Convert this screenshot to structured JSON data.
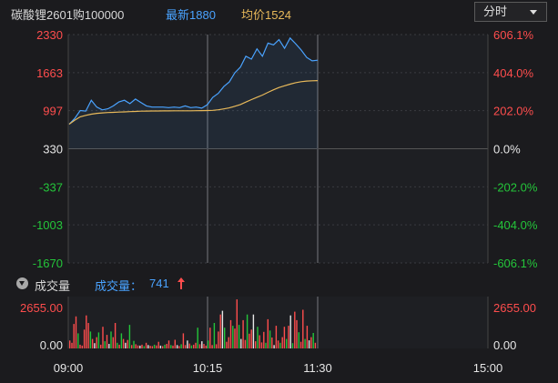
{
  "header": {
    "title": "碳酸锂2601购100000",
    "latest": "最新1880",
    "average": "均价1524",
    "period_label": "分时"
  },
  "volume_header": {
    "title": "成交量",
    "label": "成交量：",
    "value": "741"
  },
  "colors": {
    "up": "#ff4d4d",
    "down": "#24c53a",
    "price_line": "#4aa3ff",
    "avg_line": "#e8b95a",
    "neutral": "#e6e6e6"
  },
  "chart_data": [
    {
      "type": "line",
      "series": [
        {
          "values": [
            760,
            860,
            1000,
            990,
            1180,
            1060,
            1010,
            1030,
            1080,
            1150,
            1180,
            1120,
            1200,
            1140,
            1080,
            1060,
            1060,
            1060,
            1050,
            1060,
            1050,
            1080,
            1050,
            1060,
            1040,
            1100,
            1230,
            1300,
            1420,
            1500,
            1660,
            1760,
            1950,
            1900,
            2080,
            1950,
            2180,
            2150,
            2240,
            2090,
            2270,
            2170,
            2060,
            1930,
            1870,
            1880
          ]
        },
        {
          "values": [
            760,
            830,
            890,
            915,
            935,
            950,
            958,
            964,
            968,
            972,
            976,
            980,
            984,
            988,
            990,
            991,
            992,
            993,
            993,
            994,
            994,
            995,
            995,
            996,
            997,
            999,
            1003,
            1012,
            1028,
            1046,
            1074,
            1104,
            1148,
            1190,
            1232,
            1270,
            1318,
            1362,
            1402,
            1432,
            1462,
            1487,
            1505,
            1515,
            1520,
            1524
          ]
        }
      ],
      "y_left_ticks": [
        "2330",
        "1663",
        "997",
        "330",
        "-337",
        "-1003",
        "-1670"
      ],
      "y_right_ticks": [
        "606.1%",
        "404.0%",
        "202.0%",
        "0.0%",
        "-202.0%",
        "-404.0%",
        "-606.1%"
      ],
      "ylim": [
        -1670,
        2330
      ],
      "x_ticks": [
        "09:00",
        "10:15",
        "11:30",
        "15:00"
      ],
      "grid": true
    },
    {
      "type": "bar",
      "y_left_ticks": [
        "2655.00",
        "0.00"
      ],
      "y_right_ticks": [
        "2655.00",
        "0.00"
      ],
      "ylim": [
        0,
        2655
      ],
      "values": [
        420,
        300,
        1300,
        1700,
        800,
        200,
        150,
        1000,
        1750,
        1350,
        900,
        500,
        280,
        600,
        850,
        200,
        1150,
        380,
        720,
        240,
        900,
        600,
        1350,
        300,
        200,
        800,
        500,
        300,
        450,
        1250,
        180,
        400,
        220,
        160,
        150,
        200,
        120,
        300,
        180,
        140,
        120,
        200,
        160,
        350,
        150,
        120,
        200,
        240,
        420,
        180,
        150,
        460,
        180,
        130,
        220,
        800,
        180,
        420,
        260,
        160,
        200,
        300,
        1100,
        220,
        380,
        240,
        150,
        420,
        1100,
        180,
        1350,
        220,
        900,
        1800,
        2000,
        1100,
        350,
        600,
        1500,
        1200,
        1050,
        2600,
        1250,
        500,
        1500,
        450,
        1800,
        780,
        1000,
        1800,
        380,
        1150,
        700,
        320,
        880,
        300,
        1550,
        950,
        580,
        180,
        1200,
        420,
        300,
        600,
        1150,
        500,
        1200,
        1750,
        280,
        1950,
        1500,
        860,
        350,
        2050,
        500,
        1200,
        430,
        600,
        820,
        300
      ],
      "colors": [
        "up",
        "up",
        "up",
        "up",
        "down",
        "up",
        "up",
        "up",
        "up",
        "up",
        "down",
        "up",
        "neutral",
        "up",
        "down",
        "up",
        "up",
        "down",
        "up",
        "neutral",
        "down",
        "up",
        "up",
        "down",
        "up",
        "down",
        "up",
        "neutral",
        "up",
        "down",
        "up",
        "down",
        "up",
        "up",
        "neutral",
        "up",
        "down",
        "up",
        "neutral",
        "up",
        "up",
        "down",
        "up",
        "up",
        "neutral",
        "up",
        "down",
        "up",
        "up",
        "down",
        "up",
        "up",
        "neutral",
        "up",
        "down",
        "up",
        "up",
        "neutral",
        "up",
        "down",
        "up",
        "up",
        "down",
        "up",
        "neutral",
        "up",
        "up",
        "down",
        "up",
        "up",
        "down",
        "up",
        "up",
        "up",
        "neutral",
        "down",
        "up",
        "up",
        "up",
        "down",
        "up",
        "up",
        "down",
        "neutral",
        "up",
        "up",
        "down",
        "up",
        "up",
        "neutral",
        "up",
        "down",
        "up",
        "up",
        "up",
        "down",
        "up",
        "down",
        "up",
        "neutral",
        "up",
        "up",
        "down",
        "up",
        "up",
        "down",
        "up",
        "neutral",
        "down",
        "up",
        "up",
        "down",
        "up",
        "up",
        "down",
        "up",
        "neutral",
        "up",
        "down",
        "up",
        "up"
      ]
    }
  ]
}
